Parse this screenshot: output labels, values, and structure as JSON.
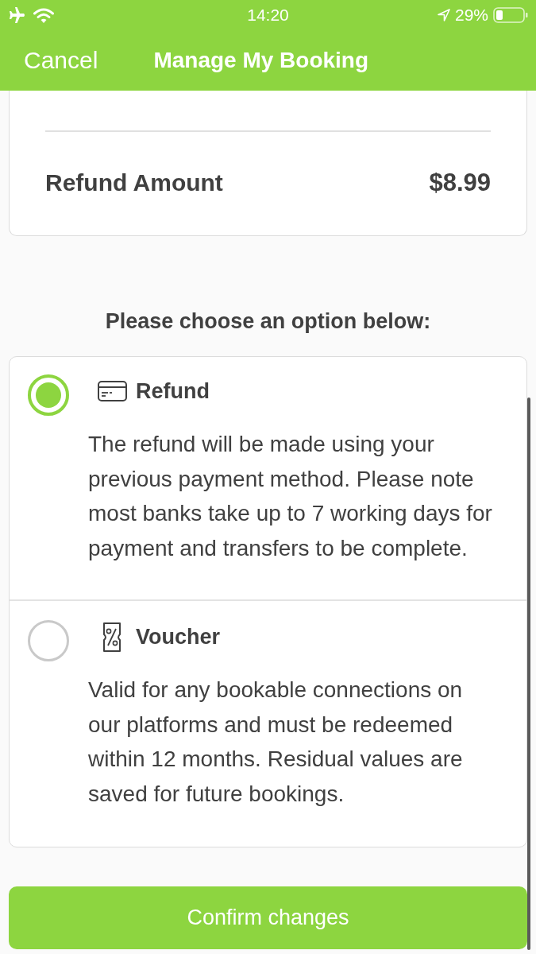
{
  "status_bar": {
    "time": "14:20",
    "battery": "29%"
  },
  "nav_bar": {
    "cancel": "Cancel",
    "title": "Manage My Booking"
  },
  "summary": {
    "label": "Refund Amount",
    "amount": "$8.99"
  },
  "prompt": "Please choose an option below:",
  "options": [
    {
      "kind": "refund",
      "title": "Refund",
      "description": "The refund will be made using your previous payment method. Please note most banks take up to 7 working days for payment and transfers to be complete.",
      "selected": true
    },
    {
      "kind": "voucher",
      "title": "Voucher",
      "description": "Valid for any bookable connections on our platforms and must be redeemed within 12 months. Residual values are saved for future bookings.",
      "selected": false
    }
  ],
  "confirm_button": "Confirm changes"
}
